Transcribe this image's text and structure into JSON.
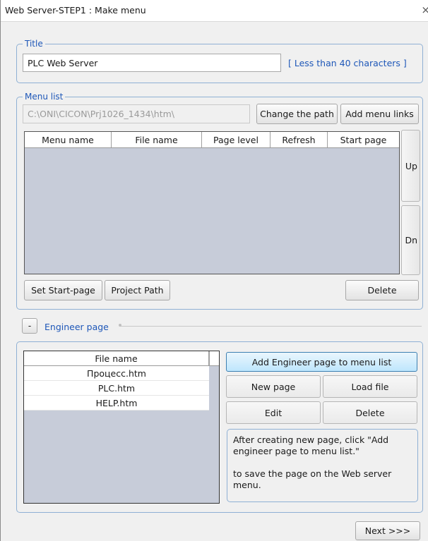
{
  "window": {
    "title": "Web Server-STEP1 : Make menu",
    "close_glyph": "×"
  },
  "title_group": {
    "legend": "Title",
    "value": "PLC Web Server",
    "hint": "[ Less than 40 characters ]"
  },
  "menu_list": {
    "legend": "Menu list",
    "path": "C:\\ONI\\CICON\\Prj1026_1434\\htm\\",
    "change_path": "Change the path",
    "add_links": "Add menu links",
    "columns": [
      "Menu name",
      "File name",
      "Page level",
      "Refresh",
      "Start page"
    ],
    "up": "Up",
    "dn": "Dn",
    "set_start": "Set Start-page",
    "project_path": "Project Path",
    "delete": "Delete"
  },
  "engineer": {
    "toggle": "-",
    "label": "Engineer page",
    "table_header": "File name",
    "files": [
      "Процесс.htm",
      "PLC.htm",
      "HELP.htm"
    ],
    "add_to_menu": "Add Engineer page to menu list",
    "new_page": "New page",
    "load_file": "Load file",
    "edit": "Edit",
    "delete": "Delete",
    "desc1": "After creating new page, click \"Add engineer page to menu list.\"",
    "desc2": "to save the page on the Web server menu."
  },
  "footer": {
    "next": "Next >>>"
  }
}
